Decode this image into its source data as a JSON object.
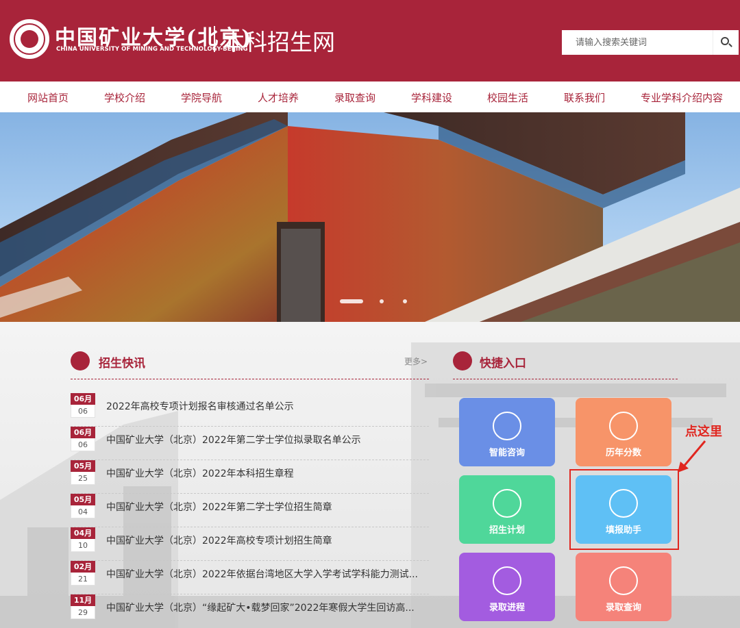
{
  "header": {
    "logo_cn": "中国矿业大学(北京)",
    "logo_en": "CHINA UNIVERSITY OF MINING AND TECHNOLOGY-BEIJING",
    "site_title": "本科招生网",
    "search_placeholder": "请输入搜索关键词",
    "brand_color": "#a8243a"
  },
  "nav": {
    "items": [
      "网站首页",
      "学校介绍",
      "学院导航",
      "人才培养",
      "录取查询",
      "学科建设",
      "校园生活",
      "联系我们",
      "专业学科介绍内容"
    ]
  },
  "news": {
    "title": "招生快讯",
    "more": "更多>",
    "items": [
      {
        "month": "06月",
        "day": "06",
        "title": "2022年高校专项计划报名审核通过名单公示"
      },
      {
        "month": "06月",
        "day": "06",
        "title": "中国矿业大学（北京）2022年第二学士学位拟录取名单公示"
      },
      {
        "month": "05月",
        "day": "25",
        "title": "中国矿业大学（北京）2022年本科招生章程"
      },
      {
        "month": "05月",
        "day": "04",
        "title": "中国矿业大学（北京）2022年第二学士学位招生简章"
      },
      {
        "month": "04月",
        "day": "10",
        "title": "中国矿业大学（北京）2022年高校专项计划招生简章"
      },
      {
        "month": "02月",
        "day": "21",
        "title": "中国矿业大学（北京）2022年依据台湾地区大学入学考试学科能力测试..."
      },
      {
        "month": "11月",
        "day": "29",
        "title": "中国矿业大学（北京）“缘起矿大•载梦回家”2022年寒假大学生回访高..."
      }
    ]
  },
  "quick": {
    "title": "快捷入口",
    "tiles": [
      {
        "label": "智能咨询",
        "icon": "bell-icon",
        "color": "#6a8fe6"
      },
      {
        "label": "历年分数",
        "icon": "clipboard-icon",
        "color": "#f79469"
      },
      {
        "label": "招生计划",
        "icon": "house-icon",
        "color": "#4fd79a"
      },
      {
        "label": "填报助手",
        "icon": "chart-icon",
        "color": "#5fc0f5"
      },
      {
        "label": "录取进程",
        "icon": "flower-icon",
        "color": "#a35ce0"
      },
      {
        "label": "录取查询",
        "icon": "users-icon",
        "color": "#f5837a"
      }
    ]
  },
  "annotation": {
    "text": "点这里",
    "color": "#e0261f"
  }
}
